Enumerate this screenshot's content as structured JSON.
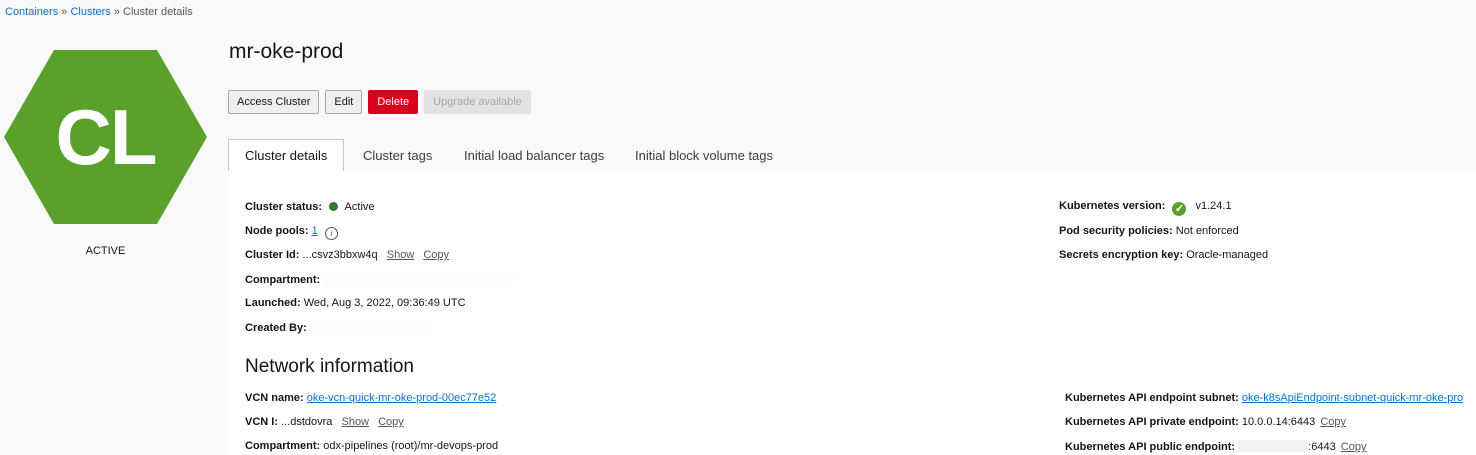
{
  "breadcrumb": {
    "items": [
      "Containers",
      "Clusters"
    ],
    "separator": "»",
    "current": "Cluster details"
  },
  "badge": {
    "initials": "CL",
    "color": "#5aa12c",
    "state": "ACTIVE"
  },
  "title": "mr-oke-prod",
  "actions": {
    "access_cluster": "Access Cluster",
    "edit": "Edit",
    "delete": "Delete",
    "upgrade": "Upgrade available"
  },
  "tabs": [
    {
      "label": "Cluster details",
      "active": true
    },
    {
      "label": "Cluster tags",
      "active": false
    },
    {
      "label": "Initial load balancer tags",
      "active": false
    },
    {
      "label": "Initial block volume tags",
      "active": false
    }
  ],
  "details": {
    "cluster_status": {
      "label": "Cluster status:",
      "value": "Active"
    },
    "node_pools": {
      "label": "Node pools:",
      "value": "1"
    },
    "cluster_id": {
      "label": "Cluster Id:",
      "value": "...csvz3bbxw4q",
      "show": "Show",
      "copy": "Copy"
    },
    "compartment": {
      "label": "Compartment:",
      "value": ""
    },
    "launched": {
      "label": "Launched:",
      "value": "Wed, Aug 3, 2022, 09:36:49 UTC"
    },
    "created_by": {
      "label": "Created By:",
      "value": ""
    },
    "k8s_version": {
      "label": "Kubernetes version:",
      "value": "v1.24.1"
    },
    "pod_security": {
      "label": "Pod security policies:",
      "value": "Not enforced"
    },
    "secrets_key": {
      "label": "Secrets encryption key:",
      "value": "Oracle-managed"
    }
  },
  "network": {
    "title": "Network information",
    "vcn_name": {
      "label": "VCN name:",
      "value": "oke-vcn-quick-mr-oke-prod-00ec77e52"
    },
    "vcn_id": {
      "label": "VCN I:",
      "value": "...dstdovra",
      "show": "Show",
      "copy": "Copy"
    },
    "compartment": {
      "label": "Compartment:",
      "value": "odx-pipelines (root)/mr-devops-prod"
    },
    "api_subnet": {
      "label": "Kubernetes API endpoint subnet:",
      "value": "oke-k8sApiEndpoint-subnet-quick-mr-oke-pro"
    },
    "api_private": {
      "label": "Kubernetes API private endpoint:",
      "value": "10.0.0.14:6443",
      "copy": "Copy"
    },
    "api_public": {
      "label": "Kubernetes API public endpoint:",
      "value": ":6443",
      "copy": "Copy"
    }
  }
}
